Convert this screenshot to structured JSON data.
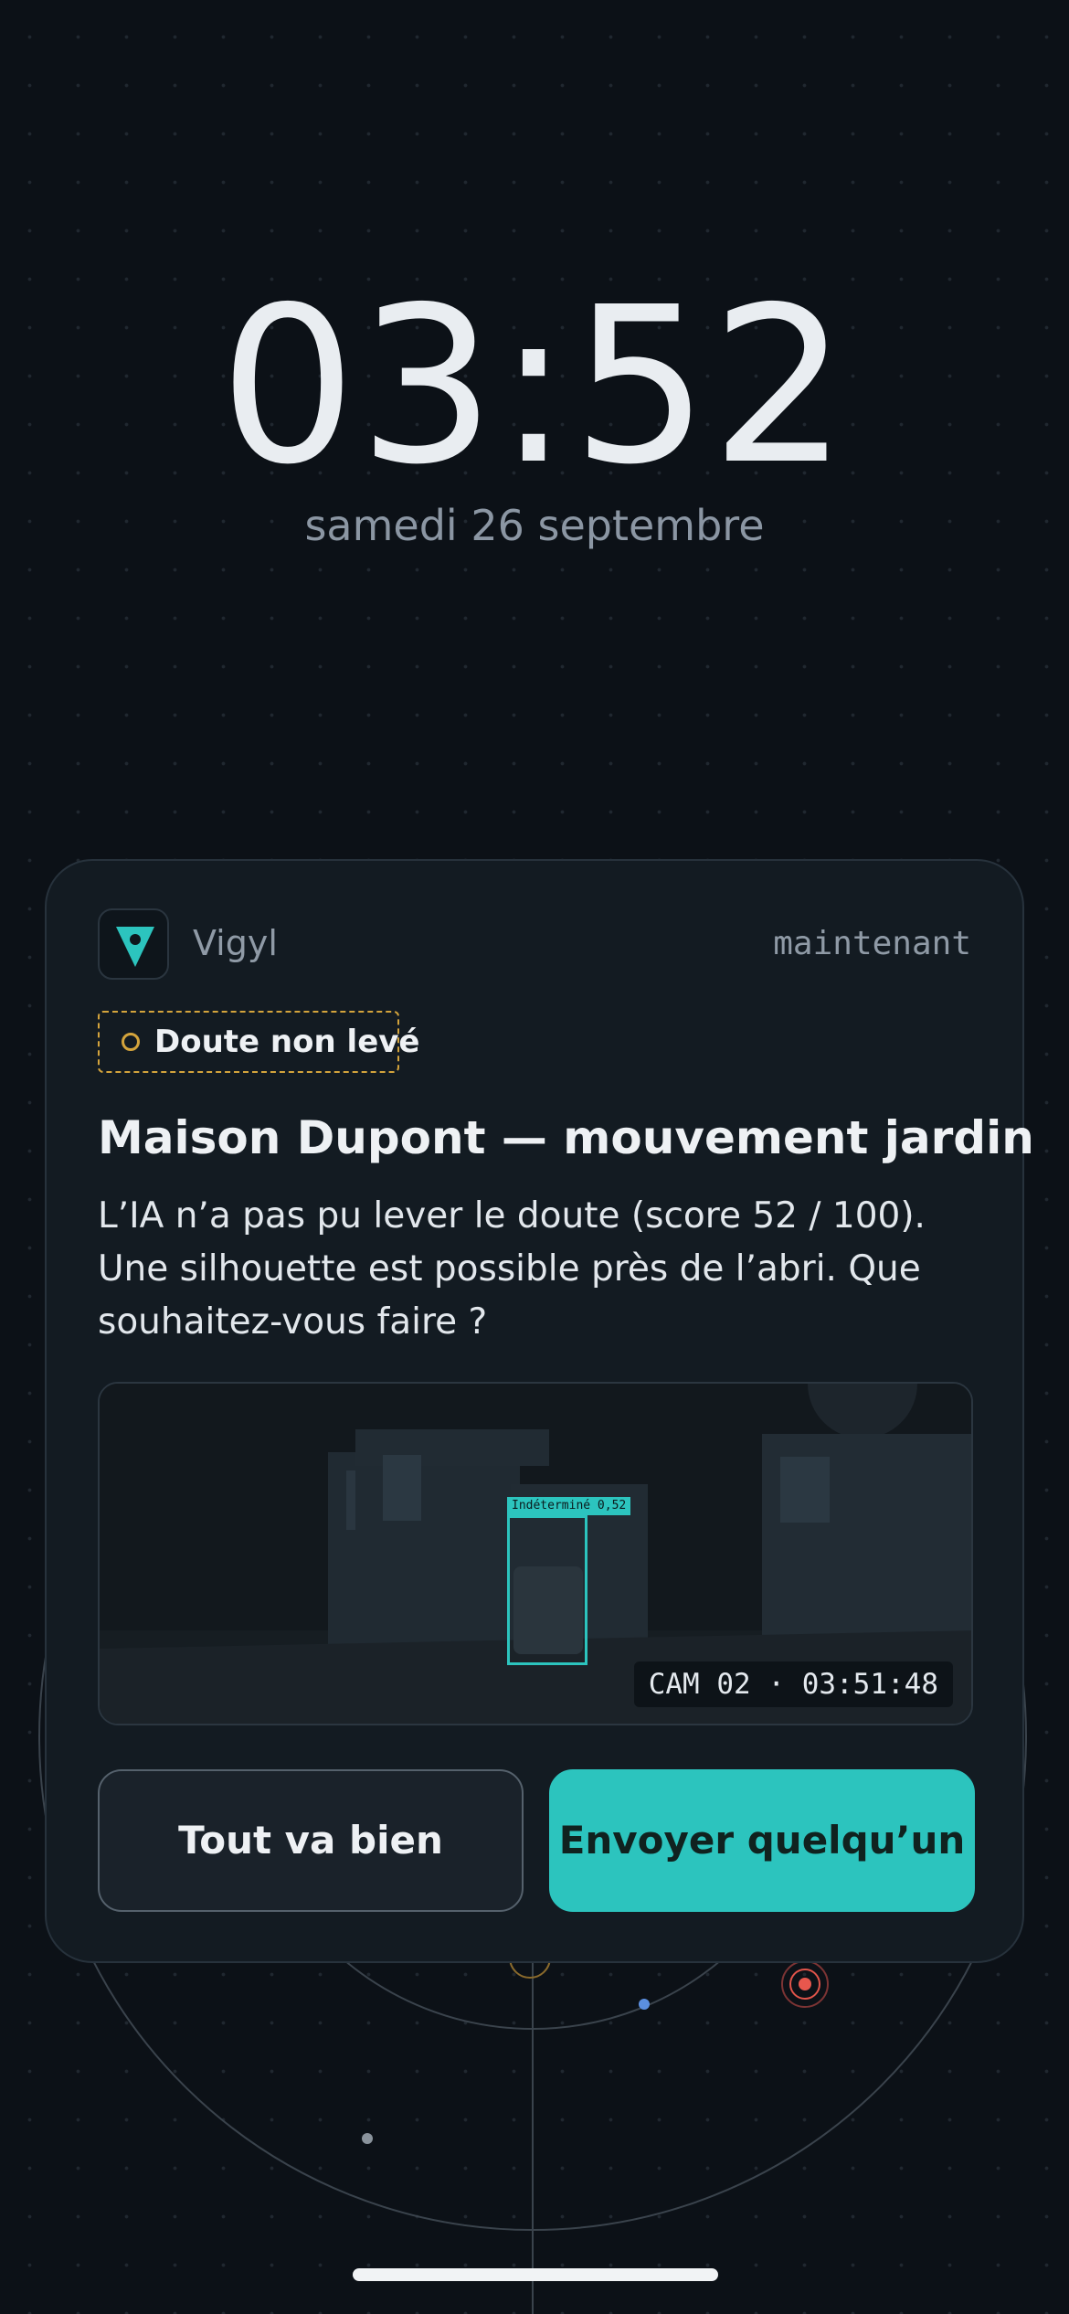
{
  "lockscreen": {
    "time": "03:52",
    "date": "samedi 26 septembre"
  },
  "notification": {
    "app_icon": "vigyl-pin-icon",
    "app_name": "Vigyl",
    "time_ago": "maintenant",
    "badge": {
      "icon": "status-circle-icon",
      "label": "Doute non levé",
      "color": "#d4a43c"
    },
    "title": "Maison Dupont — mouvement jardin",
    "body": "L’IA n’a pas pu lever le doute (score 52 / 100). Une silhouette est possible près de l’abri. Que souhaitez-vous faire ?",
    "snapshot": {
      "detection_label": "Indéterminé 0,52",
      "camera_label": "CAM 02 · 03:51:48"
    },
    "actions": {
      "dismiss_label": "Tout va bien",
      "dispatch_label": "Envoyer quelqu’un"
    }
  },
  "colors": {
    "accent": "#2cc4be",
    "warning": "#d4a43c",
    "background": "#0c1117",
    "card": "#131b22"
  }
}
